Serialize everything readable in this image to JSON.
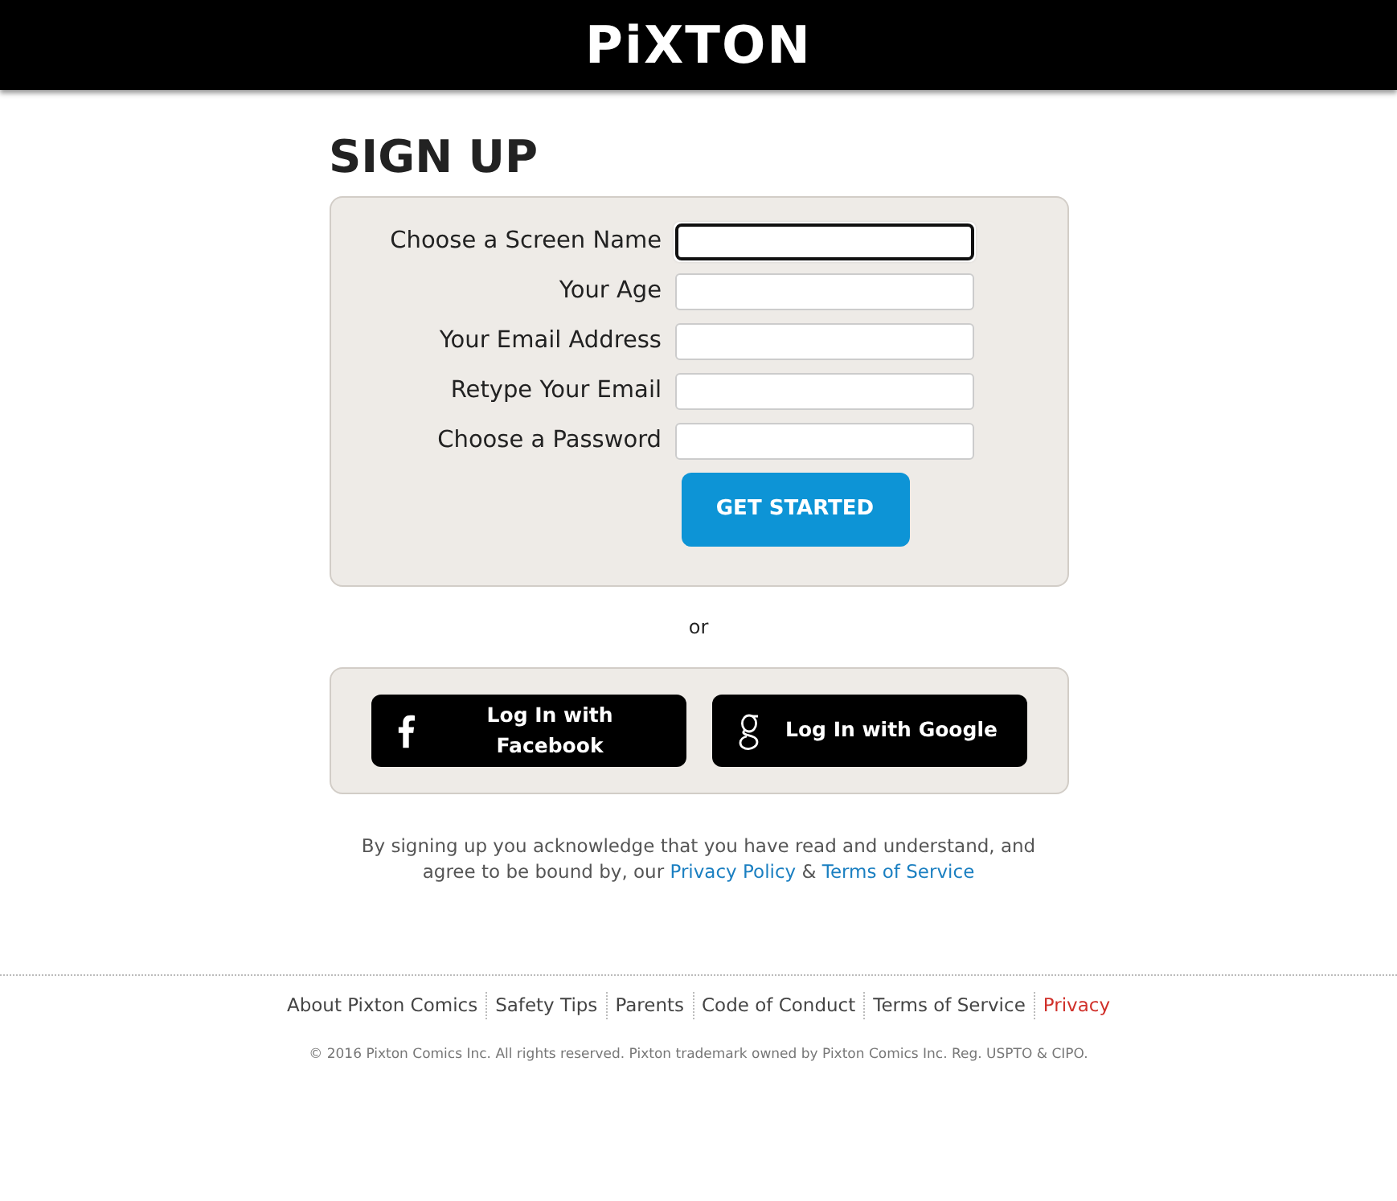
{
  "header": {
    "logo": "PiXTON"
  },
  "title": "SIGN UP",
  "fields": [
    {
      "label": "Choose a Screen Name",
      "focused": true
    },
    {
      "label": "Your Age",
      "focused": false
    },
    {
      "label": "Your Email Address",
      "focused": false
    },
    {
      "label": "Retype Your Email",
      "focused": false
    },
    {
      "label": "Choose a Password",
      "focused": false
    }
  ],
  "submit": "GET STARTED",
  "separator": "or",
  "social_buttons": [
    {
      "kind": "facebook",
      "label": "Log In with Facebook"
    },
    {
      "kind": "google",
      "label": "Log In with Google"
    }
  ],
  "legal": {
    "text": "By signing up you acknowledge that you have read and understand, and agree to be bound by, our",
    "links": [
      "Privacy Policy",
      "Terms of Service"
    ],
    "joiner": "&"
  },
  "footer_links": [
    {
      "label": "About Pixton Comics",
      "selected": false
    },
    {
      "label": "Safety Tips",
      "selected": false
    },
    {
      "label": "Parents",
      "selected": false
    },
    {
      "label": "Code of Conduct",
      "selected": false
    },
    {
      "label": "Terms of Service",
      "selected": false
    },
    {
      "label": "Privacy",
      "selected": true
    }
  ],
  "copyright": "© 2016 Pixton Comics Inc. All rights reserved. Pixton trademark owned by Pixton Comics Inc. Reg. USPTO & CIPO."
}
